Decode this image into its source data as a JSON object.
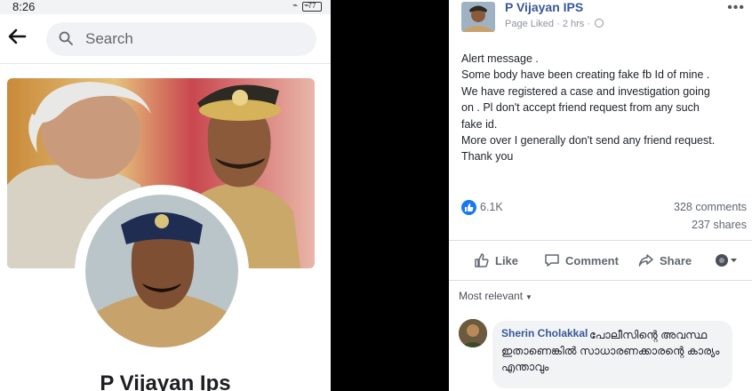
{
  "left_screen": {
    "status_bar": {
      "time": "8:26",
      "battery": "77",
      "status_icons": "⌁ ⌁"
    },
    "search": {
      "placeholder": "Search"
    },
    "profile": {
      "name": "P Vijayan Ips"
    }
  },
  "post": {
    "author": "P Vijayan IPS",
    "meta": "Page Liked · 2 hrs ·",
    "more_icon": "•••",
    "lines": [
      "Alert message .",
      "Some body have been creating fake fb Id of mine .",
      "We have registered a case and investigation going",
      "on . Pl don't accept friend request from any such",
      "fake id.",
      "More over I generally don't send any friend request.",
      "Thank you"
    ],
    "reactions": {
      "count": "6.1K",
      "comments": "328 comments",
      "shares": "237 shares"
    },
    "actions": {
      "like": "Like",
      "comment": "Comment",
      "share": "Share"
    },
    "sort_label": "Most relevant",
    "comment": {
      "author": "Sherin Cholakkal",
      "text": "പോലീസിന്റെ അവസ്ഥ ഇതാണെങ്കിൽ സാധാരണക്കാരന്റെ കാര്യം എന്താവും"
    }
  },
  "colors": {
    "link_blue": "#385898",
    "fb_blue": "#1877f2",
    "muted": "#606770",
    "divider_black": "#000000"
  },
  "icons": [
    "back-arrow-icon",
    "search-icon",
    "globe-icon",
    "more-icon",
    "like-reaction-icon",
    "like-icon",
    "comment-icon",
    "share-icon",
    "audience-icon"
  ]
}
